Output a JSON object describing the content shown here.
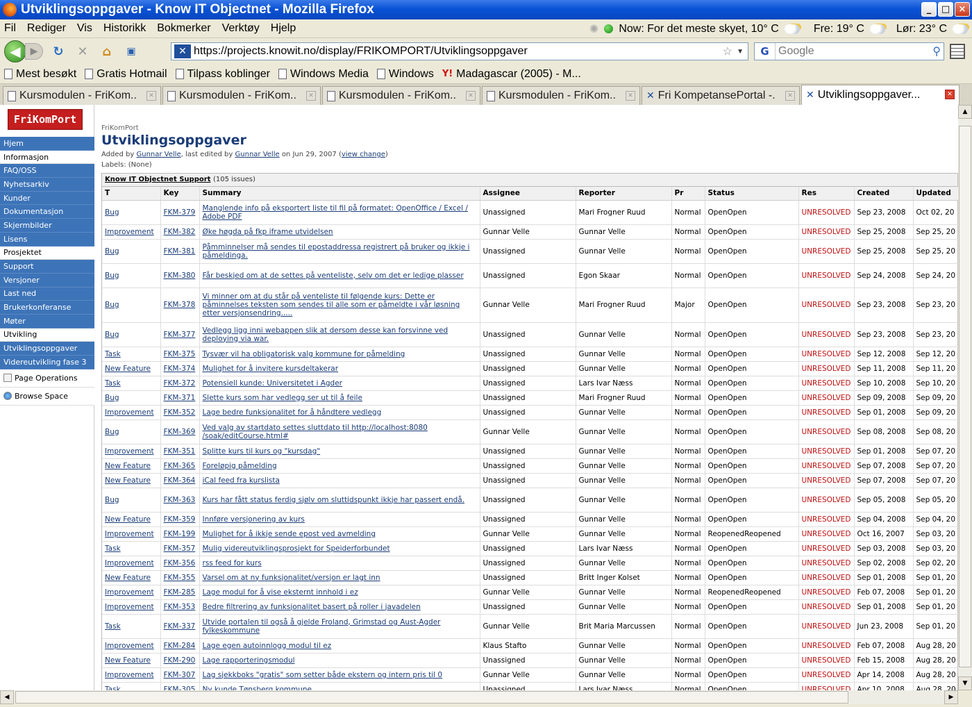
{
  "window": {
    "title": "Utviklingsoppgaver - Know IT Objectnet - Mozilla Firefox",
    "minimize": "_",
    "maximize": "□",
    "close": "×"
  },
  "menu": [
    "Fil",
    "Rediger",
    "Vis",
    "Historikk",
    "Bokmerker",
    "Verktøy",
    "Hjelp"
  ],
  "weather": {
    "now": "Now: For det meste skyet, 10° C",
    "fri": "Fre: 19° C",
    "lor": "Lør: 23° C"
  },
  "nav": {
    "url": "https://projects.knowit.no/display/FRIKOMPORT/Utviklingsoppgaver",
    "search_placeholder": "Google"
  },
  "bookmarks": [
    "Mest besøkt",
    "Gratis Hotmail",
    "Tilpass koblinger",
    "Windows Media",
    "Windows",
    "Madagascar (2005) - M..."
  ],
  "tabs": [
    {
      "label": "Kursmodulen - FriKom..."
    },
    {
      "label": "Kursmodulen - FriKom..."
    },
    {
      "label": "Kursmodulen - FriKom..."
    },
    {
      "label": "Kursmodulen - FriKom..."
    },
    {
      "label": "Fri KompetansePortal -..."
    },
    {
      "label": "Utviklingsoppgaver..."
    }
  ],
  "sidebar": {
    "logo": "FriKomPort",
    "items": [
      {
        "label": "Hjem",
        "kind": "link"
      },
      {
        "label": "Informasjon",
        "kind": "section"
      },
      {
        "label": "FAQ/OSS",
        "kind": "link"
      },
      {
        "label": "Nyhetsarkiv",
        "kind": "link"
      },
      {
        "label": "Kunder",
        "kind": "link"
      },
      {
        "label": "Dokumentasjon",
        "kind": "link"
      },
      {
        "label": "Skjermbilder",
        "kind": "link"
      },
      {
        "label": "Lisens",
        "kind": "link"
      },
      {
        "label": "Prosjektet",
        "kind": "section"
      },
      {
        "label": "Support",
        "kind": "link"
      },
      {
        "label": "Versjoner",
        "kind": "link"
      },
      {
        "label": "Last ned",
        "kind": "link"
      },
      {
        "label": "Brukerkonferanse",
        "kind": "link"
      },
      {
        "label": "Møter",
        "kind": "link"
      },
      {
        "label": "Utvikling",
        "kind": "section"
      },
      {
        "label": "Utviklingsoppgaver",
        "kind": "link"
      },
      {
        "label": "Videreutvikling fase 3",
        "kind": "link"
      }
    ],
    "ops": [
      {
        "label": "Page Operations",
        "icon": "page-icon"
      },
      {
        "label": "Browse Space",
        "icon": "globe-icon"
      }
    ]
  },
  "page": {
    "breadcrumb": "FriKomPort",
    "title": "Utviklingsoppgaver",
    "added_by_prefix": "Added by",
    "author": "Gunnar Velle",
    "edited_prefix": ", last edited by",
    "editor": "Gunnar Velle",
    "date_text": "on Jun 29, 2007",
    "view_change": "view change",
    "labels": "Labels: (None)"
  },
  "jira": {
    "title": "Know IT Objectnet Support",
    "count": "(105 issues)",
    "columns": [
      "T",
      "Key",
      "Summary",
      "Assignee",
      "Reporter",
      "Pr",
      "Status",
      "Res",
      "Created",
      "Updated"
    ],
    "rows": [
      {
        "t": "Bug",
        "key": "FKM-379",
        "summary": "Manglende info på eksportert liste til fil på formatet: OpenOffice / Excel / Adobe PDF",
        "assignee": "Unassigned",
        "reporter": "Mari Frogner Ruud",
        "pr": "Normal",
        "status": "OpenOpen",
        "res": "UNRESOLVED",
        "created": "Sep 23, 2008",
        "updated": "Oct 02, 20",
        "h": 2
      },
      {
        "t": "Improvement",
        "key": "FKM-382",
        "summary": "Øke høgda på fkp iframe utvidelsen",
        "assignee": "Gunnar Velle",
        "reporter": "Gunnar Velle",
        "pr": "Normal",
        "status": "OpenOpen",
        "res": "UNRESOLVED",
        "created": "Sep 25, 2008",
        "updated": "Sep 25, 20",
        "h": 1
      },
      {
        "t": "Bug",
        "key": "FKM-381",
        "summary": "Påmminnelser må sendes til epostaddressa registrert på bruker og ikkje i påmeldinga.",
        "assignee": "Unassigned",
        "reporter": "Gunnar Velle",
        "pr": "Normal",
        "status": "OpenOpen",
        "res": "UNRESOLVED",
        "created": "Sep 25, 2008",
        "updated": "Sep 25, 20",
        "h": 2
      },
      {
        "t": "Bug",
        "key": "FKM-380",
        "summary": "Får beskjed om at de settes på venteliste, selv om det er ledige plasser",
        "assignee": "Unassigned",
        "reporter": "Egon Skaar",
        "pr": "Normal",
        "status": "OpenOpen",
        "res": "UNRESOLVED",
        "created": "Sep 24, 2008",
        "updated": "Sep 24, 20",
        "h": 2
      },
      {
        "t": "Bug",
        "key": "FKM-378",
        "summary": "Vi minner om at du står på venteliste til følgende kurs: Dette er påminnelses teksten som sendes til alle som er påmeldte i vår løsning etter versjonsendring.....",
        "assignee": "Gunnar Velle",
        "reporter": "Mari Frogner Ruud",
        "pr": "Major",
        "status": "OpenOpen",
        "res": "UNRESOLVED",
        "created": "Sep 23, 2008",
        "updated": "Sep 23, 20",
        "h": 3
      },
      {
        "t": "Bug",
        "key": "FKM-377",
        "summary": "Vedlegg ligg inni webappen slik at dersom desse kan forsvinne ved deploying via war.",
        "assignee": "Unassigned",
        "reporter": "Gunnar Velle",
        "pr": "Normal",
        "status": "OpenOpen",
        "res": "UNRESOLVED",
        "created": "Sep 23, 2008",
        "updated": "Sep 23, 20",
        "h": 2
      },
      {
        "t": "Task",
        "key": "FKM-375",
        "summary": "Tysvær vil ha obligatorisk valg kommune for påmelding",
        "assignee": "Unassigned",
        "reporter": "Gunnar Velle",
        "pr": "Normal",
        "status": "OpenOpen",
        "res": "UNRESOLVED",
        "created": "Sep 12, 2008",
        "updated": "Sep 12, 20",
        "h": 1
      },
      {
        "t": "New Feature",
        "key": "FKM-374",
        "summary": "Mulighet for å invitere kursdeltakerar",
        "assignee": "Unassigned",
        "reporter": "Gunnar Velle",
        "pr": "Normal",
        "status": "OpenOpen",
        "res": "UNRESOLVED",
        "created": "Sep 11, 2008",
        "updated": "Sep 11, 20",
        "h": 1
      },
      {
        "t": "Task",
        "key": "FKM-372",
        "summary": "Potensiell kunde: Universitetet i Agder",
        "assignee": "Unassigned",
        "reporter": "Lars Ivar Næss",
        "pr": "Normal",
        "status": "OpenOpen",
        "res": "UNRESOLVED",
        "created": "Sep 10, 2008",
        "updated": "Sep 10, 20",
        "h": 1
      },
      {
        "t": "Bug",
        "key": "FKM-371",
        "summary": "Slette kurs som har vedlegg ser ut til å feile",
        "assignee": "Unassigned",
        "reporter": "Mari Frogner Ruud",
        "pr": "Normal",
        "status": "OpenOpen",
        "res": "UNRESOLVED",
        "created": "Sep 09, 2008",
        "updated": "Sep 09, 20",
        "h": 1
      },
      {
        "t": "Improvement",
        "key": "FKM-352",
        "summary": "Lage bedre funksjonalitet for å håndtere vedlegg",
        "assignee": "Unassigned",
        "reporter": "Gunnar Velle",
        "pr": "Normal",
        "status": "OpenOpen",
        "res": "UNRESOLVED",
        "created": "Sep 01, 2008",
        "updated": "Sep 09, 20",
        "h": 1
      },
      {
        "t": "Bug",
        "key": "FKM-369",
        "summary": "Ved valg av startdato settes sluttdato til http://localhost:8080 /soak/editCourse.html#",
        "assignee": "Gunnar Velle",
        "reporter": "Gunnar Velle",
        "pr": "Normal",
        "status": "OpenOpen",
        "res": "UNRESOLVED",
        "created": "Sep 08, 2008",
        "updated": "Sep 08, 20",
        "h": 2
      },
      {
        "t": "Improvement",
        "key": "FKM-351",
        "summary": "Splitte kurs til kurs og \"kursdag\"",
        "assignee": "Unassigned",
        "reporter": "Gunnar Velle",
        "pr": "Normal",
        "status": "OpenOpen",
        "res": "UNRESOLVED",
        "created": "Sep 01, 2008",
        "updated": "Sep 07, 20",
        "h": 1
      },
      {
        "t": "New Feature",
        "key": "FKM-365",
        "summary": "Foreløpig påmelding",
        "assignee": "Unassigned",
        "reporter": "Gunnar Velle",
        "pr": "Normal",
        "status": "OpenOpen",
        "res": "UNRESOLVED",
        "created": "Sep 07, 2008",
        "updated": "Sep 07, 20",
        "h": 1
      },
      {
        "t": "New Feature",
        "key": "FKM-364",
        "summary": "iCal feed fra kurslista",
        "assignee": "Unassigned",
        "reporter": "Gunnar Velle",
        "pr": "Normal",
        "status": "OpenOpen",
        "res": "UNRESOLVED",
        "created": "Sep 07, 2008",
        "updated": "Sep 07, 20",
        "h": 1
      },
      {
        "t": "Bug",
        "key": "FKM-363",
        "summary": "Kurs har fått status ferdig sjølv om sluttidspunkt ikkje har passert endå.",
        "assignee": "Unassigned",
        "reporter": "Gunnar Velle",
        "pr": "Normal",
        "status": "OpenOpen",
        "res": "UNRESOLVED",
        "created": "Sep 05, 2008",
        "updated": "Sep 05, 20",
        "h": 2
      },
      {
        "t": "New Feature",
        "key": "FKM-359",
        "summary": "Innføre versjonering av kurs",
        "assignee": "Unassigned",
        "reporter": "Gunnar Velle",
        "pr": "Normal",
        "status": "OpenOpen",
        "res": "UNRESOLVED",
        "created": "Sep 04, 2008",
        "updated": "Sep 04, 20",
        "h": 1
      },
      {
        "t": "Improvement",
        "key": "FKM-199",
        "summary": "Mulighet for å ikkje sende epost ved avmelding",
        "assignee": "Gunnar Velle",
        "reporter": "Gunnar Velle",
        "pr": "Normal",
        "status": "ReopenedReopened",
        "res": "UNRESOLVED",
        "created": "Oct 16, 2007",
        "updated": "Sep 03, 20",
        "h": 1
      },
      {
        "t": "Task",
        "key": "FKM-357",
        "summary": "Mulig videreutviklingsprosjekt for Speiderforbundet",
        "assignee": "Unassigned",
        "reporter": "Lars Ivar Næss",
        "pr": "Normal",
        "status": "OpenOpen",
        "res": "UNRESOLVED",
        "created": "Sep 03, 2008",
        "updated": "Sep 03, 20",
        "h": 1
      },
      {
        "t": "Improvement",
        "key": "FKM-356",
        "summary": "rss feed for kurs",
        "assignee": "Unassigned",
        "reporter": "Gunnar Velle",
        "pr": "Normal",
        "status": "OpenOpen",
        "res": "UNRESOLVED",
        "created": "Sep 02, 2008",
        "updated": "Sep 02, 20",
        "h": 1
      },
      {
        "t": "New Feature",
        "key": "FKM-355",
        "summary": "Varsel om at ny funksjonalitet/versjon er lagt inn",
        "assignee": "Unassigned",
        "reporter": "Britt Inger Kolset",
        "pr": "Normal",
        "status": "OpenOpen",
        "res": "UNRESOLVED",
        "created": "Sep 01, 2008",
        "updated": "Sep 01, 20",
        "h": 1
      },
      {
        "t": "Improvement",
        "key": "FKM-285",
        "summary": "Lage modul for å vise eksternt innhold i ez",
        "assignee": "Gunnar Velle",
        "reporter": "Gunnar Velle",
        "pr": "Normal",
        "status": "ReopenedReopened",
        "res": "UNRESOLVED",
        "created": "Feb 07, 2008",
        "updated": "Sep 01, 20",
        "h": 1
      },
      {
        "t": "Improvement",
        "key": "FKM-353",
        "summary": "Bedre filtrering av funksjonalitet basert på roller i javadelen",
        "assignee": "Unassigned",
        "reporter": "Gunnar Velle",
        "pr": "Normal",
        "status": "OpenOpen",
        "res": "UNRESOLVED",
        "created": "Sep 01, 2008",
        "updated": "Sep 01, 20",
        "h": 1
      },
      {
        "t": "Task",
        "key": "FKM-337",
        "summary": "Utvide portalen til også å gjelde Froland, Grimstad og Aust-Agder fylkeskommune",
        "assignee": "Gunnar Velle",
        "reporter": "Brit Maria Marcussen",
        "pr": "Normal",
        "status": "OpenOpen",
        "res": "UNRESOLVED",
        "created": "Jun 23, 2008",
        "updated": "Sep 01, 20",
        "h": 2
      },
      {
        "t": "Improvement",
        "key": "FKM-284",
        "summary": "Lage egen autoinnlogg modul til ez",
        "assignee": "Klaus Stafto",
        "reporter": "Gunnar Velle",
        "pr": "Normal",
        "status": "OpenOpen",
        "res": "UNRESOLVED",
        "created": "Feb 07, 2008",
        "updated": "Aug 28, 20",
        "h": 1
      },
      {
        "t": "New Feature",
        "key": "FKM-290",
        "summary": "Lage rapporteringsmodul",
        "assignee": "Unassigned",
        "reporter": "Gunnar Velle",
        "pr": "Normal",
        "status": "OpenOpen",
        "res": "UNRESOLVED",
        "created": "Feb 15, 2008",
        "updated": "Aug 28, 20",
        "h": 1
      },
      {
        "t": "Improvement",
        "key": "FKM-307",
        "summary": "Lag sjekkboks \"gratis\" som setter både ekstern og intern pris til 0",
        "assignee": "Gunnar Velle",
        "reporter": "Gunnar Velle",
        "pr": "Normal",
        "status": "OpenOpen",
        "res": "UNRESOLVED",
        "created": "Apr 14, 2008",
        "updated": "Aug 28, 20",
        "h": 1
      },
      {
        "t": "Task",
        "key": "FKM-305",
        "summary": "Ny kunde Tønsberg kommune",
        "assignee": "Unassigned",
        "reporter": "Lars Ivar Næss",
        "pr": "Normal",
        "status": "OpenOpen",
        "res": "UNRESOLVED",
        "created": "Apr 10, 2008",
        "updated": "Aug 28, 20",
        "h": 1
      }
    ]
  }
}
